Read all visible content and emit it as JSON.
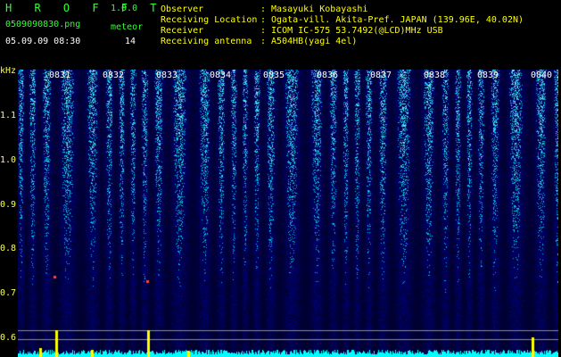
{
  "app": {
    "name": "H R O F F T",
    "version": "1.0.0"
  },
  "file": {
    "name": "0509090830.png",
    "datetime": "05.09.09 08:30"
  },
  "meteor": {
    "label": "meteor",
    "count": "14"
  },
  "info": [
    {
      "key": "Observer",
      "value": ": Masayuki Kobayashi"
    },
    {
      "key": "Receiving Location",
      "value": ": Ogata-vill. Akita-Pref. JAPAN (139.96E, 40.02N)"
    },
    {
      "key": "Receiver",
      "value": ": ICOM IC-575 53.7492(@LCD)MHz USB"
    },
    {
      "key": "Receiving antenna",
      "value": ": A504HB(yagi 4el)"
    }
  ],
  "spectrogram": {
    "y_unit": "kHz",
    "y_ticks": [
      "1.1",
      "1.0",
      "0.9",
      "0.8",
      "0.7",
      "0.6"
    ],
    "time_labels": [
      "0831",
      "0832",
      "0833",
      "0834",
      "0835",
      "0836",
      "0837",
      "0838",
      "0839",
      "0840"
    ],
    "colors": {
      "background": "#000033",
      "signal_high": "#ffff00",
      "baseline": "#00ffff"
    }
  }
}
